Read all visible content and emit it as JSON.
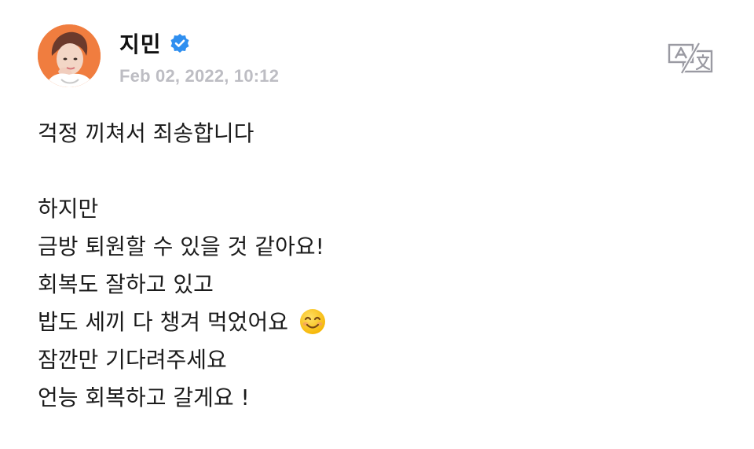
{
  "post": {
    "author": "지민",
    "verified": true,
    "timestamp": "Feb 02, 2022, 10:12",
    "translate_icon": "translate-icon",
    "lines": [
      "걱정 끼쳐서 죄송합니다",
      "",
      "하지만",
      "금방 퇴원할 수 있을 것 같아요!",
      "회복도 잘하고 있고",
      "밥도 세끼 다 챙겨 먹었어요",
      "잠깐만 기다려주세요",
      "언능 회복하고 갈게요 !"
    ],
    "emoji": "smiling-face-icon"
  },
  "colors": {
    "verified_badge": "#2f8ff0",
    "timestamp": "#bdbdc3",
    "avatar_bg": "#f07d3f",
    "text": "#1b1b1b"
  }
}
